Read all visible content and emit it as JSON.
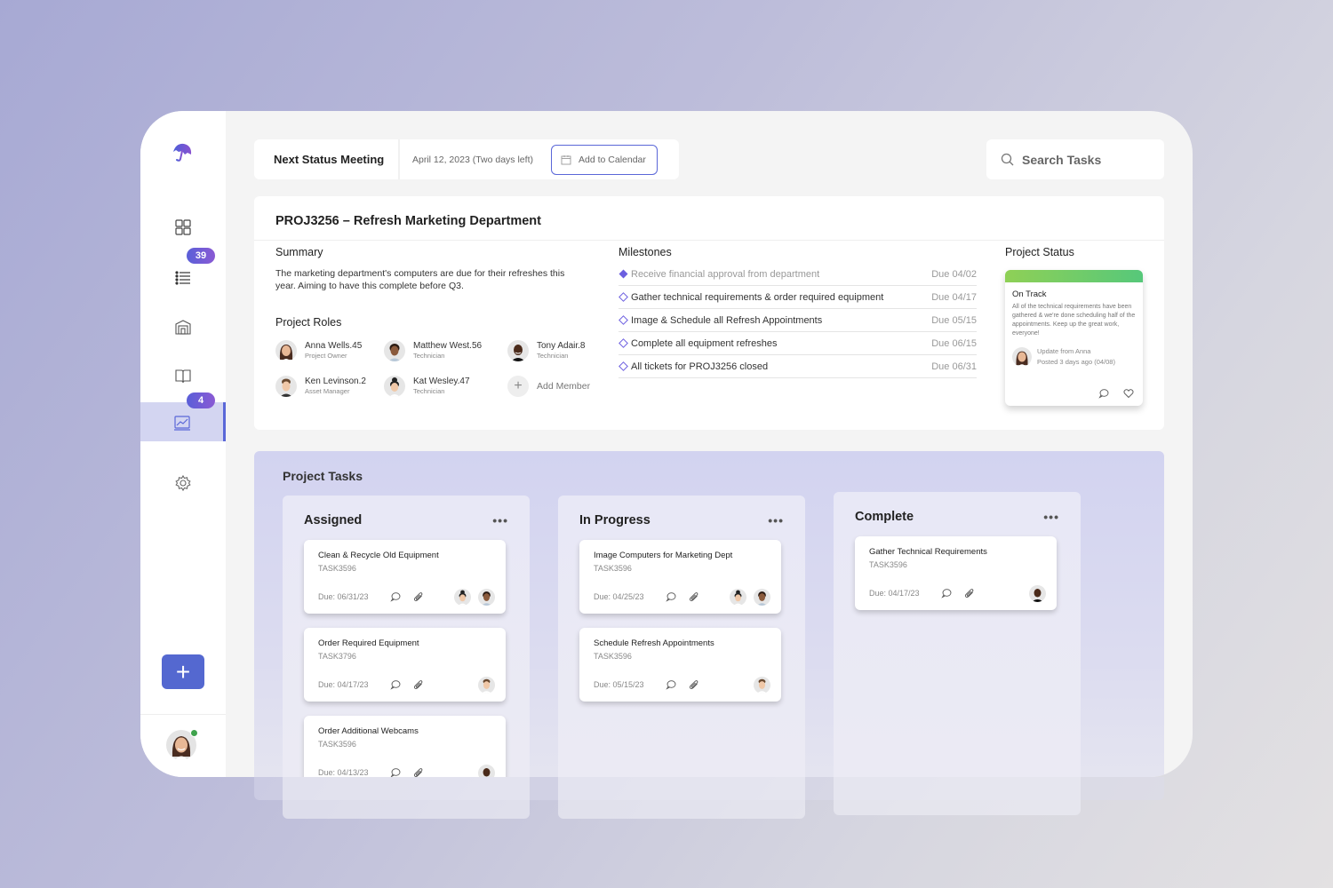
{
  "sidebar": {
    "logo": "umbrella-logo",
    "items": [
      {
        "name": "dashboard",
        "icon": "grid-icon",
        "badge": null
      },
      {
        "name": "tasks",
        "icon": "list-icon",
        "badge": "39"
      },
      {
        "name": "warehouse",
        "icon": "warehouse-icon",
        "badge": null
      },
      {
        "name": "docs",
        "icon": "book-icon",
        "badge": null
      },
      {
        "name": "reports",
        "icon": "chart-icon",
        "badge": "4",
        "active": true
      },
      {
        "name": "settings",
        "icon": "gear-icon",
        "badge": null
      }
    ],
    "add_label": "+",
    "user": {
      "name": "Anna",
      "status": "online"
    }
  },
  "header": {
    "meeting_label": "Next Status Meeting",
    "meeting_date": "April 12, 2023 (Two days left)",
    "calendar_button": "Add to Calendar",
    "search_placeholder": "Search Tasks"
  },
  "project": {
    "title": "PROJ3256 – Refresh Marketing Department",
    "summary_title": "Summary",
    "summary": "The marketing department's computers are due for their refreshes this year. Aiming to have this complete before Q3.",
    "roles_title": "Project Roles",
    "roles": [
      {
        "name": "Anna Wells.45",
        "title": "Project Owner"
      },
      {
        "name": "Matthew West.56",
        "title": "Technician"
      },
      {
        "name": "Tony Adair.8",
        "title": "Technician"
      },
      {
        "name": "Ken Levinson.2",
        "title": "Asset Manager"
      },
      {
        "name": "Kat Wesley.47",
        "title": "Technician"
      }
    ],
    "add_member": "Add Member",
    "milestones_title": "Milestones",
    "milestones": [
      {
        "label": "Receive financial approval from department",
        "due": "Due 04/02",
        "done": true
      },
      {
        "label": "Gather technical requirements & order required equipment",
        "due": "Due 04/17",
        "done": false
      },
      {
        "label": "Image & Schedule all Refresh Appointments",
        "due": "Due 05/15",
        "done": false
      },
      {
        "label": "Complete all equipment refreshes",
        "due": "Due 06/15",
        "done": false
      },
      {
        "label": "All tickets for PROJ3256 closed",
        "due": "Due 06/31",
        "done": false
      }
    ],
    "status_title": "Project Status",
    "status": {
      "label": "On Track",
      "text": "All of the technical requirements have been gathered & we're done scheduling half of the appointments. Keep up the great work, everyone!",
      "author": "Update from Anna",
      "posted": "Posted 3 days ago (04/08)",
      "color_start": "#8fd056",
      "color_end": "#56c87a"
    }
  },
  "tasks": {
    "title": "Project Tasks",
    "more": "•••",
    "columns": [
      {
        "title": "Assigned",
        "cards": [
          {
            "name": "Clean & Recycle Old Equipment",
            "id": "TASK3596",
            "due": "Due: 06/31/23",
            "assignees": [
              "Kat Wesley",
              "Matthew West"
            ]
          },
          {
            "name": "Order Required Equipment",
            "id": "TASK3796",
            "due": "Due: 04/17/23",
            "assignees": [
              "Ken Levinson"
            ]
          },
          {
            "name": "Order Additional Webcams",
            "id": "TASK3596",
            "due": "Due: 04/13/23",
            "assignees": [
              "Tony Adair"
            ]
          }
        ]
      },
      {
        "title": "In Progress",
        "cards": [
          {
            "name": "Image Computers for Marketing Dept",
            "id": "TASK3596",
            "due": "Due: 04/25/23",
            "assignees": [
              "Kat Wesley",
              "Matthew West"
            ]
          },
          {
            "name": "Schedule Refresh Appointments",
            "id": "TASK3596",
            "due": "Due: 05/15/23",
            "assignees": [
              "Ken Levinson"
            ]
          }
        ]
      },
      {
        "title": "Complete",
        "cards": [
          {
            "name": "Gather Technical Requirements",
            "id": "TASK3596",
            "due": "Due: 04/17/23",
            "assignees": [
              "Tony Adair"
            ]
          }
        ]
      }
    ]
  },
  "colors": {
    "accent": "#5a67d8",
    "badge_start": "#5a5fd8",
    "badge_end": "#8a5ad4",
    "milestone_icon": "#6c5fe0",
    "online": "#3fa34d"
  }
}
